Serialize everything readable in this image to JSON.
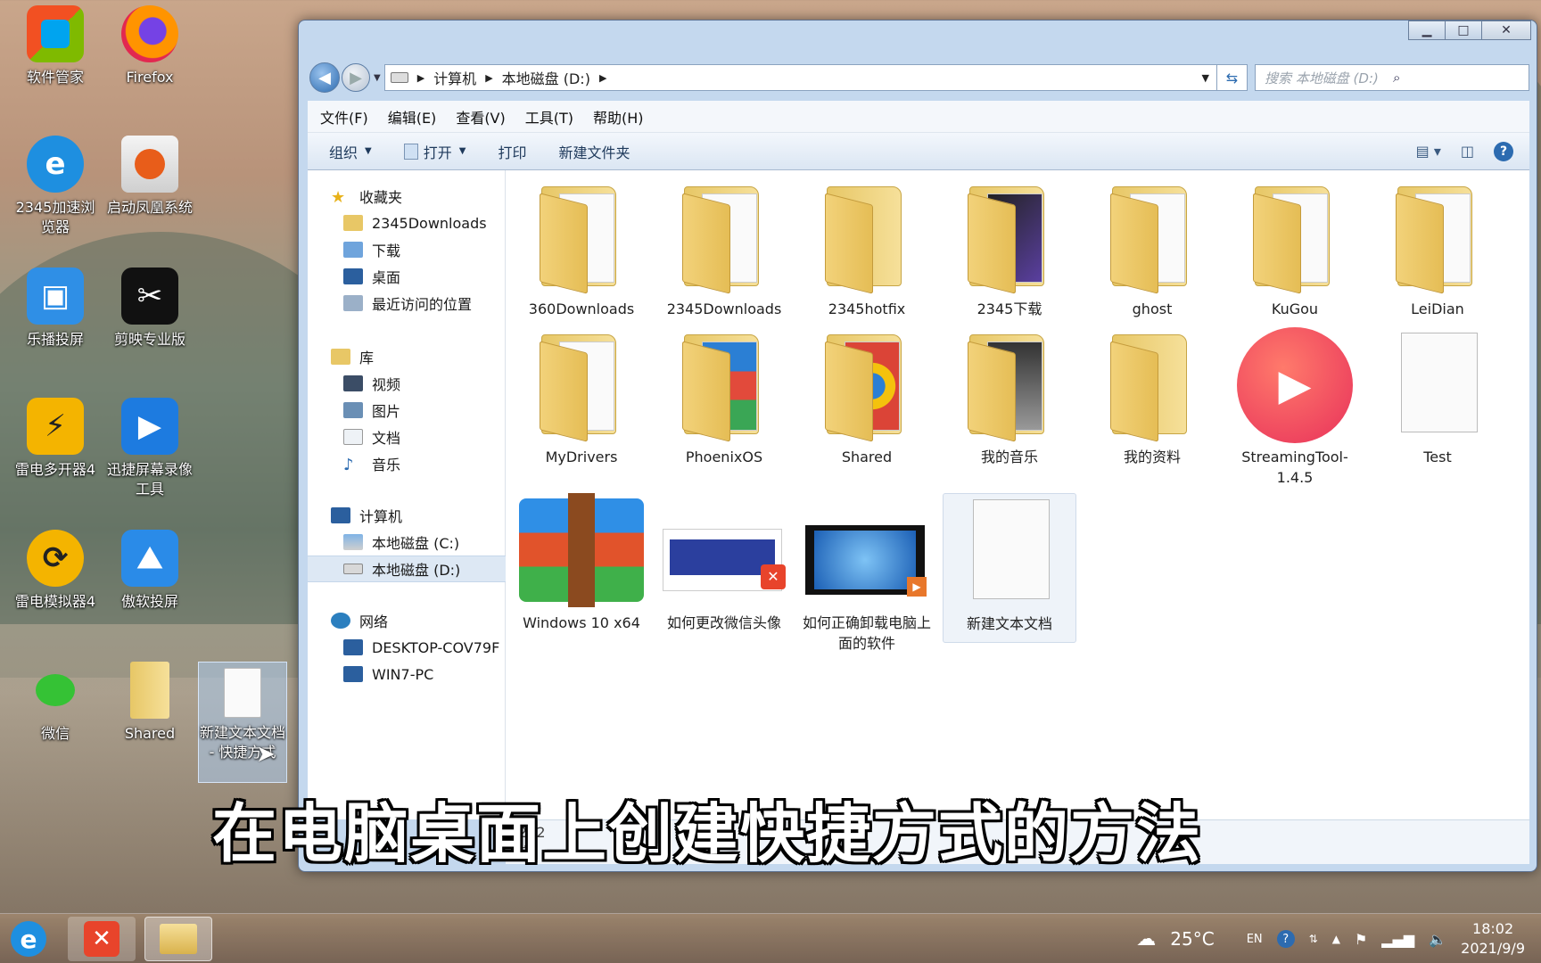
{
  "desktop": {
    "icons": [
      {
        "label": "软件管家"
      },
      {
        "label": "Firefox"
      },
      {
        "label": "2345加速浏览器"
      },
      {
        "label": "启动凤凰系统"
      },
      {
        "label": "乐播投屏"
      },
      {
        "label": "剪映专业版"
      },
      {
        "label": "雷电多开器4"
      },
      {
        "label": "迅捷屏幕录像工具"
      },
      {
        "label": "雷电模拟器4"
      },
      {
        "label": "傲软投屏"
      },
      {
        "label": "微信"
      },
      {
        "label": "Shared"
      },
      {
        "label": "新建文本文档 - 快捷方式"
      }
    ]
  },
  "window": {
    "controls": {
      "minimize": "▁",
      "maximize": "□",
      "close": "✕"
    },
    "address": {
      "crumbs": [
        "计算机",
        "本地磁盘 (D:)"
      ]
    },
    "search": {
      "placeholder": "搜索 本地磁盘 (D:)"
    },
    "menu": [
      "文件(F)",
      "编辑(E)",
      "查看(V)",
      "工具(T)",
      "帮助(H)"
    ],
    "commands": {
      "organize": "组织",
      "open": "打开",
      "print": "打印",
      "new_folder": "新建文件夹"
    },
    "nav": {
      "favorites": "收藏夹",
      "fav_items": [
        "2345Downloads",
        "下载",
        "桌面",
        "最近访问的位置"
      ],
      "libraries": "库",
      "lib_items": [
        "视频",
        "图片",
        "文档",
        "音乐"
      ],
      "computer": "计算机",
      "drives": [
        "本地磁盘 (C:)",
        "本地磁盘 (D:)"
      ],
      "network": "网络",
      "net_items": [
        "DESKTOP-COV79F",
        "WIN7-PC"
      ]
    },
    "files": [
      {
        "name": "360Downloads"
      },
      {
        "name": "2345Downloads"
      },
      {
        "name": "2345hotfix"
      },
      {
        "name": "2345下载"
      },
      {
        "name": "ghost"
      },
      {
        "name": "KuGou"
      },
      {
        "name": "LeiDian"
      },
      {
        "name": "MyDrivers"
      },
      {
        "name": "PhoenixOS"
      },
      {
        "name": "Shared"
      },
      {
        "name": "我的音乐"
      },
      {
        "name": "我的资料"
      },
      {
        "name": "StreamingTool-1.4.5"
      },
      {
        "name": "Test"
      },
      {
        "name": "Windows 10 x64"
      },
      {
        "name": "如何更改微信头像"
      },
      {
        "name": "如何正确卸载电脑上面的软件"
      },
      {
        "name": "新建文本文档"
      }
    ],
    "status_partial": [
      "202",
      "字"
    ]
  },
  "caption": "在电脑桌面上创建快捷方式的方法",
  "taskbar": {
    "weather": "25°C",
    "lang": "EN",
    "time": "18:02",
    "date": "2021/9/9"
  },
  "colors": {
    "explorer_frame": "#c4d8ee",
    "selection": "#dde8f4",
    "caption_text": "#ffffff"
  }
}
